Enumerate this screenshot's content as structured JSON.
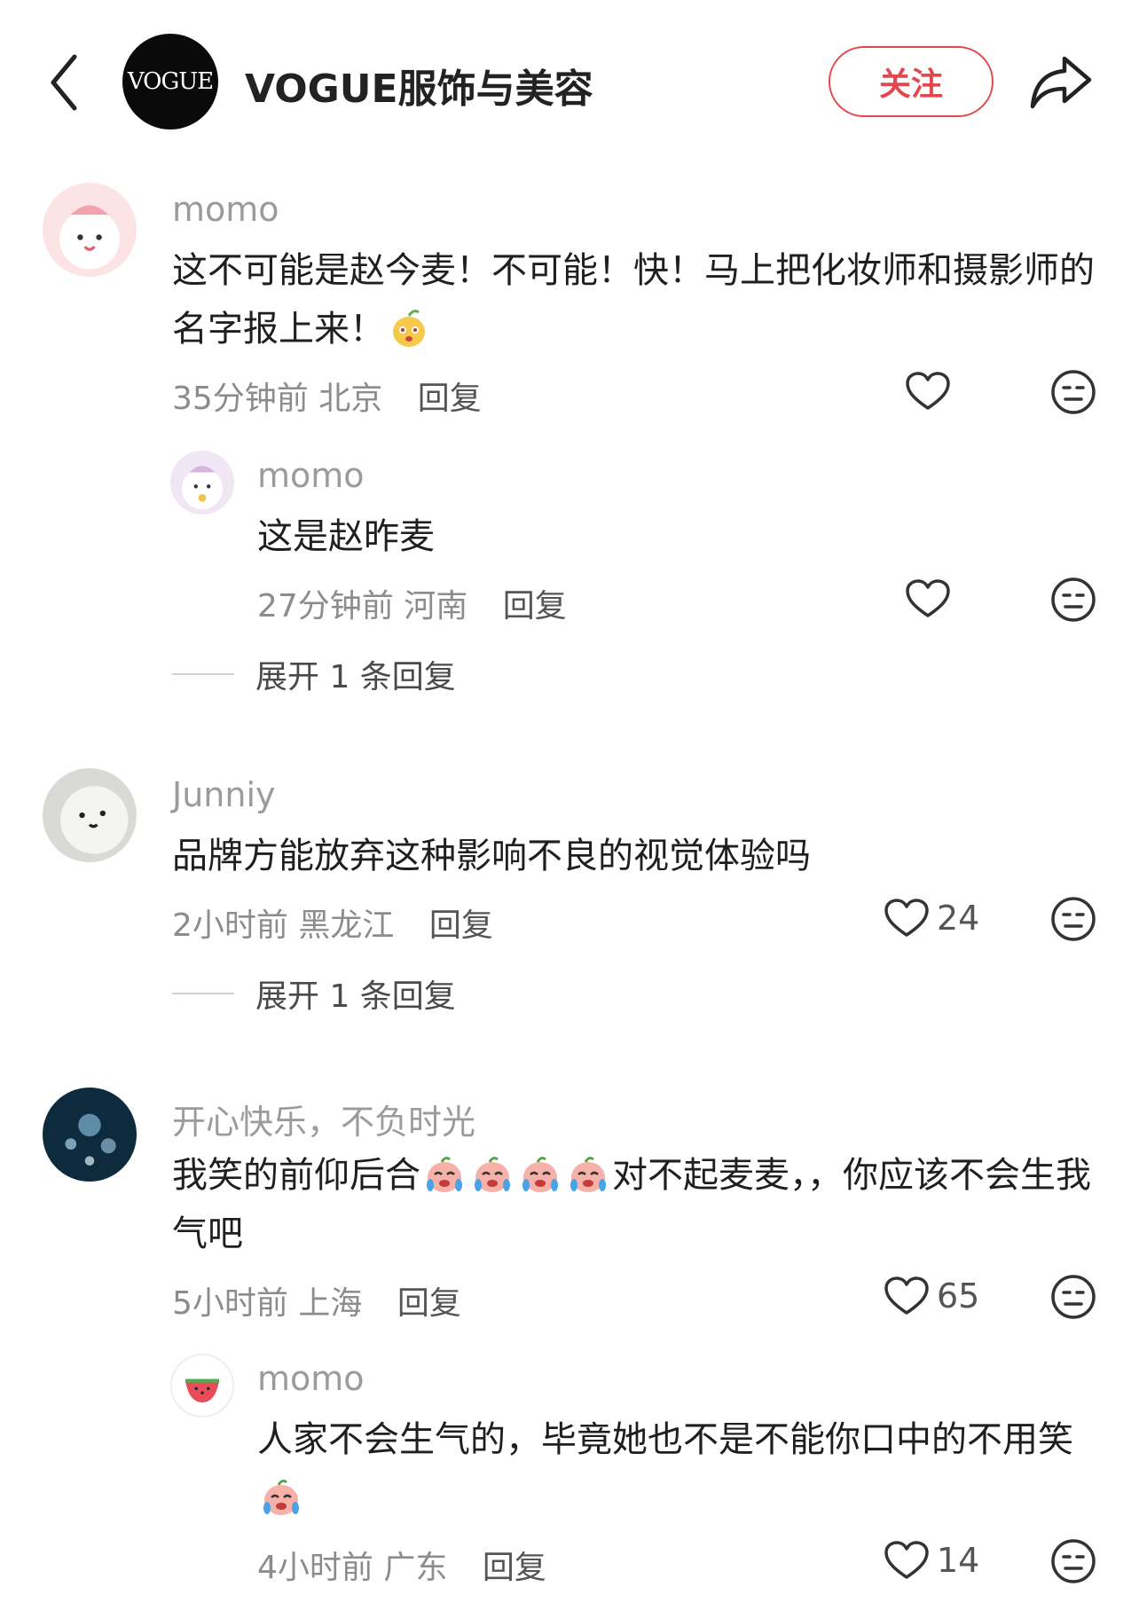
{
  "header": {
    "logo_text": "VOGUE",
    "title": "VOGUE服饰与美容",
    "follow_label": "关注",
    "icons": [
      "back-icon",
      "share-icon"
    ]
  },
  "comments": [
    {
      "username": "momo",
      "text": "这不可能是赵今麦！不可能！快！马上把化妆师和摄影师的名字报上来！",
      "time": "35分钟前",
      "location": "北京",
      "reply_label": "回复",
      "likes": ""
    },
    {
      "username": "momo",
      "text": "这是赵昨麦",
      "time": "27分钟前",
      "location": "河南",
      "reply_label": "回复",
      "likes": ""
    },
    {
      "username": "Junniy",
      "text": "品牌方能放弃这种影响不良的视觉体验吗",
      "time": "2小时前",
      "location": "黑龙江",
      "reply_label": "回复",
      "likes": "24"
    },
    {
      "username": "开心快乐，不负时光",
      "text_a": "我笑的前仰后合",
      "text_b": "对不起麦麦，，你应该不会生我气吧",
      "time": "5小时前",
      "location": "上海",
      "reply_label": "回复",
      "likes": "65"
    },
    {
      "username": "momo",
      "text": "人家不会生气的，毕竟她也不是不能你口中的不用笑",
      "time": "4小时前",
      "location": "广东",
      "reply_label": "回复",
      "likes": "14"
    }
  ],
  "expand_replies": [
    "展开 1 条回复",
    "展开 1 条回复"
  ],
  "colors": {
    "accent": "#e2484f",
    "muted": "#9b9b9b"
  }
}
